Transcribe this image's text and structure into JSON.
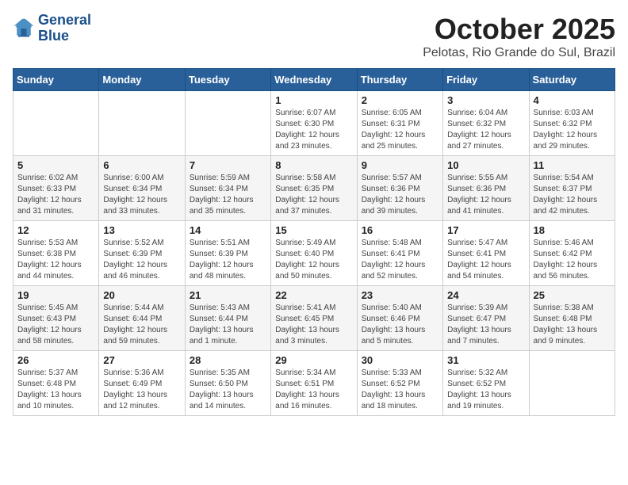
{
  "header": {
    "logo_line1": "General",
    "logo_line2": "Blue",
    "month": "October 2025",
    "location": "Pelotas, Rio Grande do Sul, Brazil"
  },
  "weekdays": [
    "Sunday",
    "Monday",
    "Tuesday",
    "Wednesday",
    "Thursday",
    "Friday",
    "Saturday"
  ],
  "weeks": [
    [
      {
        "day": "",
        "info": ""
      },
      {
        "day": "",
        "info": ""
      },
      {
        "day": "",
        "info": ""
      },
      {
        "day": "1",
        "info": "Sunrise: 6:07 AM\nSunset: 6:30 PM\nDaylight: 12 hours and 23 minutes."
      },
      {
        "day": "2",
        "info": "Sunrise: 6:05 AM\nSunset: 6:31 PM\nDaylight: 12 hours and 25 minutes."
      },
      {
        "day": "3",
        "info": "Sunrise: 6:04 AM\nSunset: 6:32 PM\nDaylight: 12 hours and 27 minutes."
      },
      {
        "day": "4",
        "info": "Sunrise: 6:03 AM\nSunset: 6:32 PM\nDaylight: 12 hours and 29 minutes."
      }
    ],
    [
      {
        "day": "5",
        "info": "Sunrise: 6:02 AM\nSunset: 6:33 PM\nDaylight: 12 hours and 31 minutes."
      },
      {
        "day": "6",
        "info": "Sunrise: 6:00 AM\nSunset: 6:34 PM\nDaylight: 12 hours and 33 minutes."
      },
      {
        "day": "7",
        "info": "Sunrise: 5:59 AM\nSunset: 6:34 PM\nDaylight: 12 hours and 35 minutes."
      },
      {
        "day": "8",
        "info": "Sunrise: 5:58 AM\nSunset: 6:35 PM\nDaylight: 12 hours and 37 minutes."
      },
      {
        "day": "9",
        "info": "Sunrise: 5:57 AM\nSunset: 6:36 PM\nDaylight: 12 hours and 39 minutes."
      },
      {
        "day": "10",
        "info": "Sunrise: 5:55 AM\nSunset: 6:36 PM\nDaylight: 12 hours and 41 minutes."
      },
      {
        "day": "11",
        "info": "Sunrise: 5:54 AM\nSunset: 6:37 PM\nDaylight: 12 hours and 42 minutes."
      }
    ],
    [
      {
        "day": "12",
        "info": "Sunrise: 5:53 AM\nSunset: 6:38 PM\nDaylight: 12 hours and 44 minutes."
      },
      {
        "day": "13",
        "info": "Sunrise: 5:52 AM\nSunset: 6:39 PM\nDaylight: 12 hours and 46 minutes."
      },
      {
        "day": "14",
        "info": "Sunrise: 5:51 AM\nSunset: 6:39 PM\nDaylight: 12 hours and 48 minutes."
      },
      {
        "day": "15",
        "info": "Sunrise: 5:49 AM\nSunset: 6:40 PM\nDaylight: 12 hours and 50 minutes."
      },
      {
        "day": "16",
        "info": "Sunrise: 5:48 AM\nSunset: 6:41 PM\nDaylight: 12 hours and 52 minutes."
      },
      {
        "day": "17",
        "info": "Sunrise: 5:47 AM\nSunset: 6:41 PM\nDaylight: 12 hours and 54 minutes."
      },
      {
        "day": "18",
        "info": "Sunrise: 5:46 AM\nSunset: 6:42 PM\nDaylight: 12 hours and 56 minutes."
      }
    ],
    [
      {
        "day": "19",
        "info": "Sunrise: 5:45 AM\nSunset: 6:43 PM\nDaylight: 12 hours and 58 minutes."
      },
      {
        "day": "20",
        "info": "Sunrise: 5:44 AM\nSunset: 6:44 PM\nDaylight: 12 hours and 59 minutes."
      },
      {
        "day": "21",
        "info": "Sunrise: 5:43 AM\nSunset: 6:44 PM\nDaylight: 13 hours and 1 minute."
      },
      {
        "day": "22",
        "info": "Sunrise: 5:41 AM\nSunset: 6:45 PM\nDaylight: 13 hours and 3 minutes."
      },
      {
        "day": "23",
        "info": "Sunrise: 5:40 AM\nSunset: 6:46 PM\nDaylight: 13 hours and 5 minutes."
      },
      {
        "day": "24",
        "info": "Sunrise: 5:39 AM\nSunset: 6:47 PM\nDaylight: 13 hours and 7 minutes."
      },
      {
        "day": "25",
        "info": "Sunrise: 5:38 AM\nSunset: 6:48 PM\nDaylight: 13 hours and 9 minutes."
      }
    ],
    [
      {
        "day": "26",
        "info": "Sunrise: 5:37 AM\nSunset: 6:48 PM\nDaylight: 13 hours and 10 minutes."
      },
      {
        "day": "27",
        "info": "Sunrise: 5:36 AM\nSunset: 6:49 PM\nDaylight: 13 hours and 12 minutes."
      },
      {
        "day": "28",
        "info": "Sunrise: 5:35 AM\nSunset: 6:50 PM\nDaylight: 13 hours and 14 minutes."
      },
      {
        "day": "29",
        "info": "Sunrise: 5:34 AM\nSunset: 6:51 PM\nDaylight: 13 hours and 16 minutes."
      },
      {
        "day": "30",
        "info": "Sunrise: 5:33 AM\nSunset: 6:52 PM\nDaylight: 13 hours and 18 minutes."
      },
      {
        "day": "31",
        "info": "Sunrise: 5:32 AM\nSunset: 6:52 PM\nDaylight: 13 hours and 19 minutes."
      },
      {
        "day": "",
        "info": ""
      }
    ]
  ]
}
